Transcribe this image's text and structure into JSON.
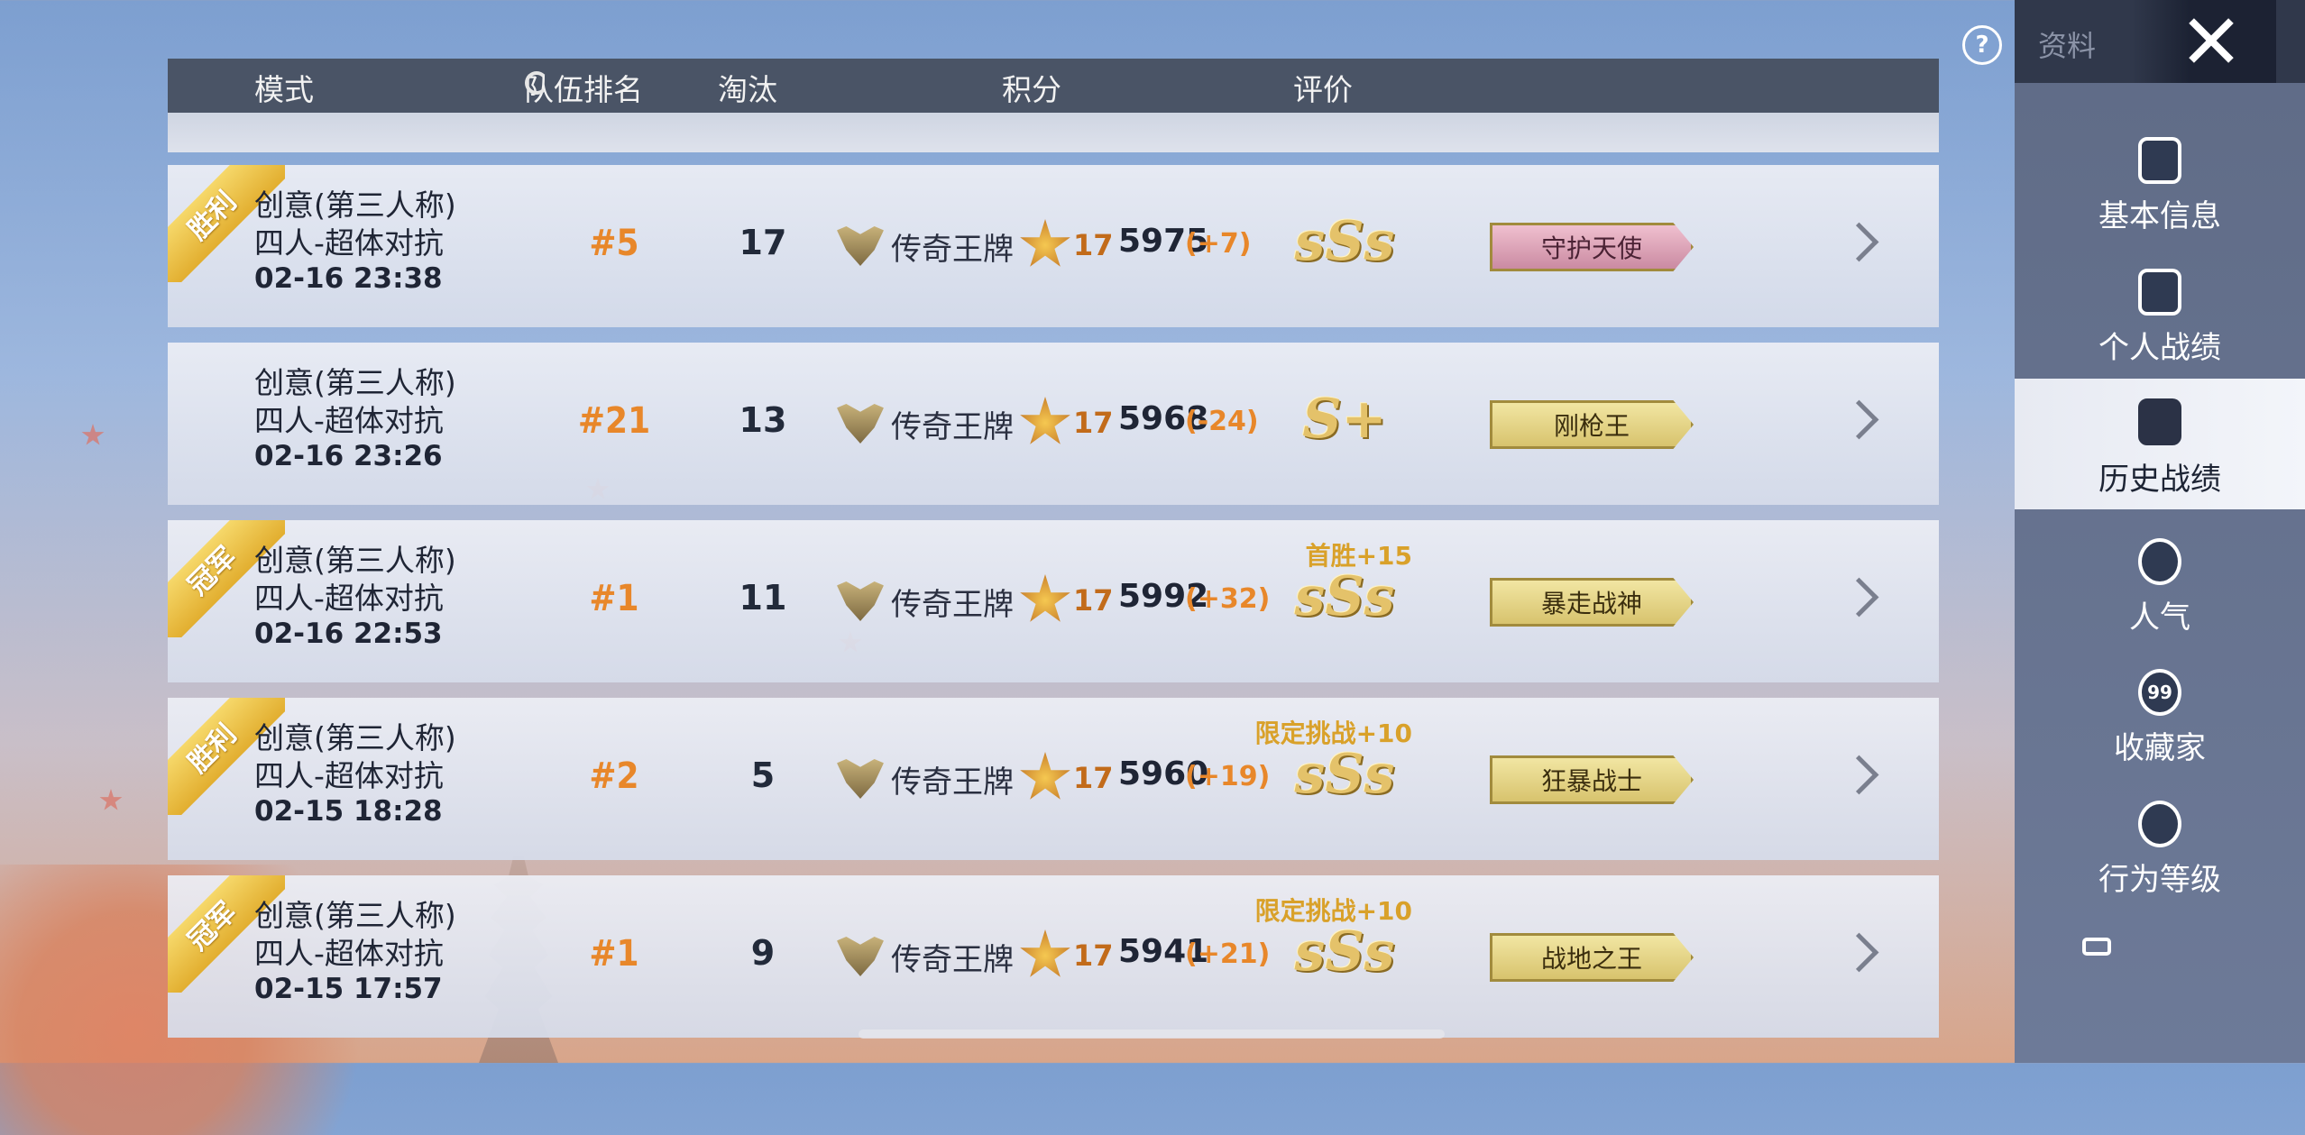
{
  "header": {
    "mode": "模式",
    "rank": "队伍排名",
    "kills": "淘汰",
    "score": "积分",
    "rating": "评价"
  },
  "matches": [
    {
      "badge": "胜利",
      "mode_line1": "创意(第三人称)",
      "mode_line2": "四人-超体对抗",
      "time": "02-16 23:38",
      "rank": "#5",
      "kills": "17",
      "bonus": "",
      "tier": "传奇王牌",
      "star_level": "17",
      "score": "5975",
      "delta": "(+7)",
      "rating": "sSs",
      "title": "守护天使",
      "title_color": "pink"
    },
    {
      "badge": "",
      "mode_line1": "创意(第三人称)",
      "mode_line2": "四人-超体对抗",
      "time": "02-16 23:26",
      "rank": "#21",
      "kills": "13",
      "bonus": "",
      "tier": "传奇王牌",
      "star_level": "17",
      "score": "5968",
      "delta": "(-24)",
      "rating": "S+",
      "title": "刚枪王",
      "title_color": "gold"
    },
    {
      "badge": "冠军",
      "mode_line1": "创意(第三人称)",
      "mode_line2": "四人-超体对抗",
      "time": "02-16 22:53",
      "rank": "#1",
      "kills": "11",
      "bonus": "首胜+15",
      "tier": "传奇王牌",
      "star_level": "17",
      "score": "5992",
      "delta": "(+32)",
      "rating": "sSs",
      "title": "暴走战神",
      "title_color": "gold"
    },
    {
      "badge": "胜利",
      "mode_line1": "创意(第三人称)",
      "mode_line2": "四人-超体对抗",
      "time": "02-15 18:28",
      "rank": "#2",
      "kills": "5",
      "bonus": "限定挑战+10",
      "tier": "传奇王牌",
      "star_level": "17",
      "score": "5960",
      "delta": "(+19)",
      "rating": "sSs",
      "title": "狂暴战士",
      "title_color": "gold"
    },
    {
      "badge": "冠军",
      "mode_line1": "创意(第三人称)",
      "mode_line2": "四人-超体对抗",
      "time": "02-15 17:57",
      "rank": "#1",
      "kills": "9",
      "bonus": "限定挑战+10",
      "tier": "传奇王牌",
      "star_level": "17",
      "score": "5941",
      "delta": "(+21)",
      "rating": "sSs",
      "title": "战地之王",
      "title_color": "gold"
    }
  ],
  "sidebar": {
    "top_label": "资料",
    "items": [
      {
        "label": "基本信息",
        "icon": "profile-icon",
        "active": false
      },
      {
        "label": "个人战绩",
        "icon": "stats-icon",
        "active": false
      },
      {
        "label": "历史战绩",
        "icon": "history-icon",
        "active": true
      },
      {
        "label": "人气",
        "icon": "popularity-icon",
        "active": false
      },
      {
        "label": "收藏家",
        "icon": "collector-icon",
        "active": false
      },
      {
        "label": "行为等级",
        "icon": "behavior-icon",
        "active": false
      }
    ],
    "collector_badge": "99"
  },
  "help_symbol": "?",
  "colors": {
    "accent_orange": "#e8872a",
    "header_bg": "#4a5466",
    "bonus_gold": "#d9a12a"
  }
}
